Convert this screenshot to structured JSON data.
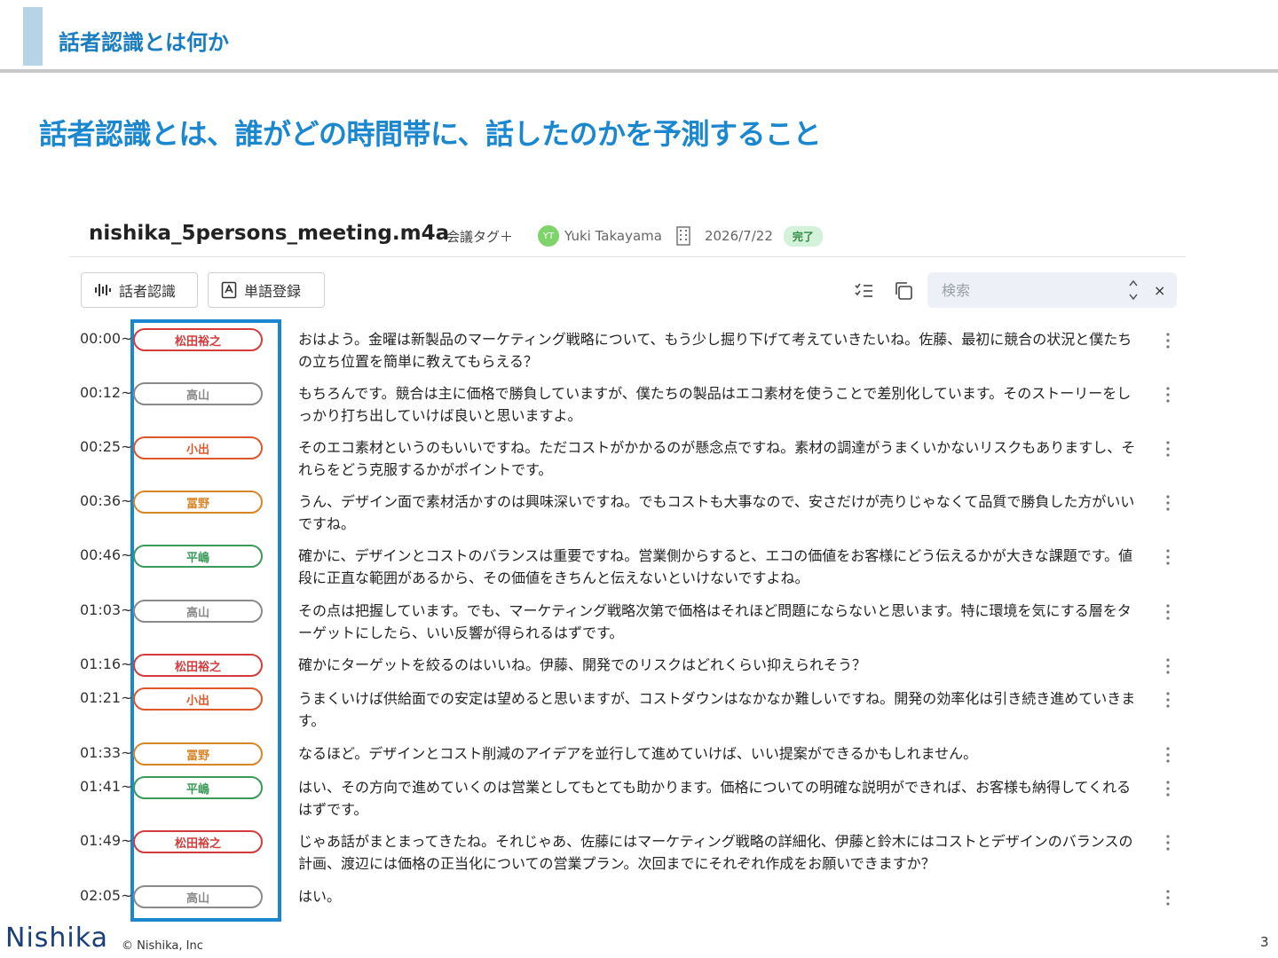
{
  "slide": {
    "section_title": "話者認識とは何か",
    "headline": "話者認識とは、誰がどの時間帯に、話したのかを予測すること",
    "footer_logo": "Nishika",
    "footer_copyright": "© Nishika, Inc",
    "page_number": "3",
    "accent_color": "#1a87cf"
  },
  "app": {
    "file_name": "nishika_5persons_meeting.m4a",
    "meeting_tag_label": "会議タグ＋",
    "user_initials": "YT",
    "user_name": "Yuki Takayama",
    "date": "2026/7/22",
    "status_badge": "完了",
    "toolbar": {
      "speaker_recognition_label": "話者認識",
      "word_register_label": "単語登録",
      "search_placeholder": "検索",
      "clear_symbol": "×",
      "icons": [
        "waveform-icon",
        "dictionary-icon",
        "checklist-icon",
        "copy-icon",
        "spinner-arrows-icon",
        "close-icon"
      ]
    },
    "speaker_colors": {
      "松田裕之": "#d63b3b",
      "高山": "#8a8a8a",
      "小出": "#e0562a",
      "冨野": "#d9862a",
      "平嶋": "#3a9a5a"
    },
    "transcript": [
      {
        "time": "00:00~",
        "speaker": "松田裕之",
        "text": "おはよう。金曜は新製品のマーケティング戦略について、もう少し掘り下げて考えていきたいね。佐藤、最初に競合の状況と僕たちの立ち位置を簡単に教えてもらえる？"
      },
      {
        "time": "00:12~",
        "speaker": "高山",
        "text": "もちろんです。競合は主に価格で勝負していますが、僕たちの製品はエコ素材を使うことで差別化しています。そのストーリーをしっかり打ち出していけば良いと思いますよ。"
      },
      {
        "time": "00:25~",
        "speaker": "小出",
        "text": "そのエコ素材というのもいいですね。ただコストがかかるのが懸念点ですね。素材の調達がうまくいかないリスクもありますし、それらをどう克服するかがポイントです。"
      },
      {
        "time": "00:36~",
        "speaker": "冨野",
        "text": "うん、デザイン面で素材活かすのは興味深いですね。でもコストも大事なので、安さだけが売りじゃなくて品質で勝負した方がいいですね。"
      },
      {
        "time": "00:46~",
        "speaker": "平嶋",
        "text": "確かに、デザインとコストのバランスは重要ですね。営業側からすると、エコの価値をお客様にどう伝えるかが大きな課題です。値段に正直な範囲があるから、その価値をきちんと伝えないといけないですよね。"
      },
      {
        "time": "01:03~",
        "speaker": "高山",
        "text": "その点は把握しています。でも、マーケティング戦略次第で価格はそれほど問題にならないと思います。特に環境を気にする層をターゲットにしたら、いい反響が得られるはずです。"
      },
      {
        "time": "01:16~",
        "speaker": "松田裕之",
        "text": "確かにターゲットを絞るのはいいね。伊藤、開発でのリスクはどれくらい抑えられそう？"
      },
      {
        "time": "01:21~",
        "speaker": "小出",
        "text": "うまくいけば供給面での安定は望めると思いますが、コストダウンはなかなか難しいですね。開発の効率化は引き続き進めていきます。"
      },
      {
        "time": "01:33~",
        "speaker": "冨野",
        "text": "なるほど。デザインとコスト削減のアイデアを並行して進めていけば、いい提案ができるかもしれません。"
      },
      {
        "time": "01:41~",
        "speaker": "平嶋",
        "text": "はい、その方向で進めていくのは営業としてもとても助かります。価格についての明確な説明ができれば、お客様も納得してくれるはずです。"
      },
      {
        "time": "01:49~",
        "speaker": "松田裕之",
        "text": "じゃあ話がまとまってきたね。それじゃあ、佐藤にはマーケティング戦略の詳細化、伊藤と鈴木にはコストとデザインのバランスの計画、渡辺には価格の正当化についての営業プラン。次回までにそれぞれ作成をお願いできますか？"
      },
      {
        "time": "02:05~",
        "speaker": "高山",
        "text": "はい。"
      }
    ]
  }
}
